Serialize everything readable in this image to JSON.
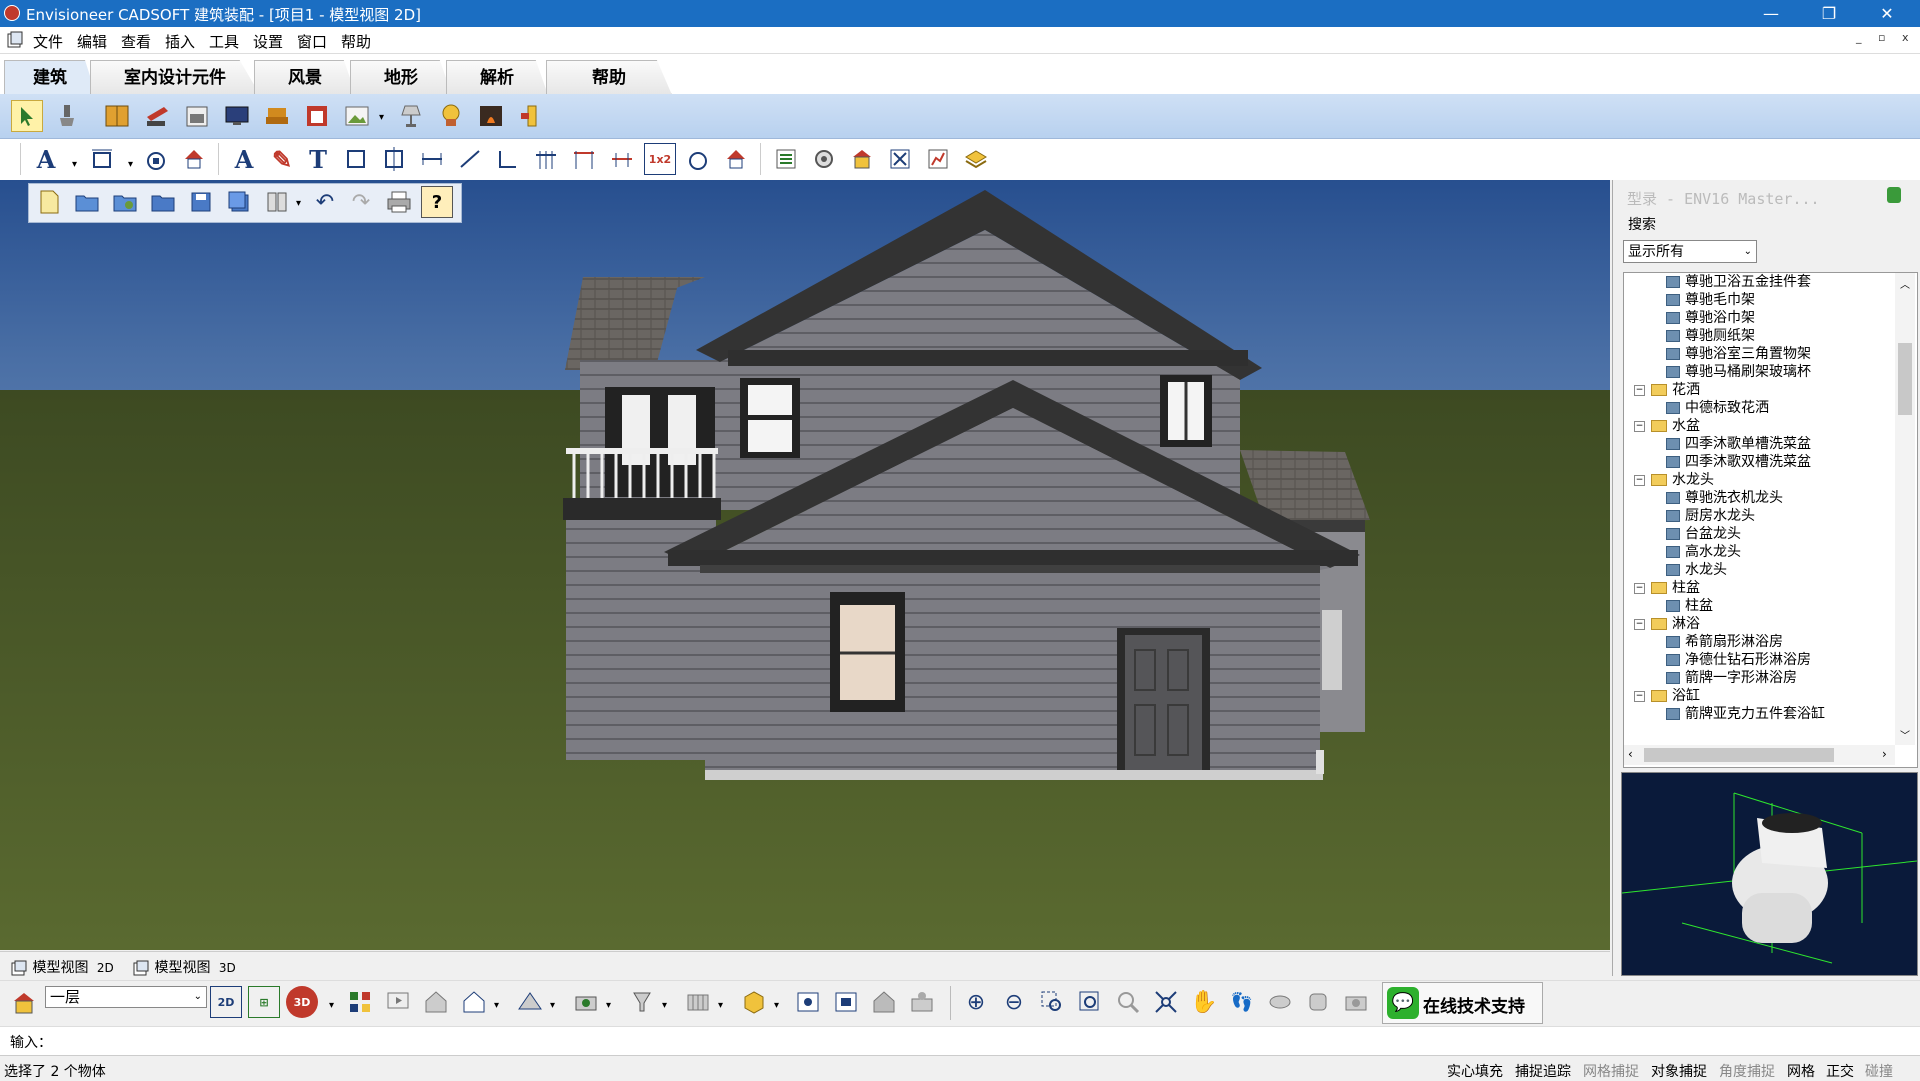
{
  "window": {
    "title": "Envisioneer CADSOFT 建筑装配 - [项目1 - 模型视图 2D]",
    "minimize": "—",
    "restore": "❐",
    "close": "✕"
  },
  "menu": [
    "文件",
    "编辑",
    "查看",
    "插入",
    "工具",
    "设置",
    "窗口",
    "帮助"
  ],
  "mdi": {
    "minimize": "_",
    "restore": "▫",
    "close": "x"
  },
  "tabs": [
    "建筑",
    "室内设计元件",
    "风景",
    "地形",
    "解析",
    "帮助"
  ],
  "ribbon2_text": {
    "a1": "A",
    "a2": "A",
    "t1": "T",
    "ratio": "1x2"
  },
  "panel": {
    "title": "型录 - ENV16 Master...",
    "search_label": "搜索",
    "filter_value": "显示所有",
    "tree": [
      {
        "label": "尊驰卫浴五金挂件套",
        "type": "item"
      },
      {
        "label": "尊驰毛巾架",
        "type": "item"
      },
      {
        "label": "尊驰浴巾架",
        "type": "item"
      },
      {
        "label": "尊驰厕纸架",
        "type": "item"
      },
      {
        "label": "尊驰浴室三角置物架",
        "type": "item"
      },
      {
        "label": "尊驰马桶刷架玻璃杯",
        "type": "item"
      },
      {
        "label": "花洒",
        "type": "folder"
      },
      {
        "label": "中德标致花洒",
        "type": "item"
      },
      {
        "label": "水盆",
        "type": "folder"
      },
      {
        "label": "四季沐歌单槽洗菜盆",
        "type": "item"
      },
      {
        "label": "四季沐歌双槽洗菜盆",
        "type": "item"
      },
      {
        "label": "水龙头",
        "type": "folder"
      },
      {
        "label": "尊驰洗衣机龙头",
        "type": "item"
      },
      {
        "label": "厨房水龙头",
        "type": "item"
      },
      {
        "label": "台盆龙头",
        "type": "item"
      },
      {
        "label": "高水龙头",
        "type": "item"
      },
      {
        "label": "水龙头",
        "type": "item"
      },
      {
        "label": "柱盆",
        "type": "folder"
      },
      {
        "label": "柱盆",
        "type": "item"
      },
      {
        "label": "淋浴",
        "type": "folder"
      },
      {
        "label": "希箭扇形淋浴房",
        "type": "item"
      },
      {
        "label": "净德仕钻石形淋浴房",
        "type": "item"
      },
      {
        "label": "箭牌一字形淋浴房",
        "type": "item"
      },
      {
        "label": "浴缸",
        "type": "folder"
      },
      {
        "label": "箭牌亚克力五件套浴缸",
        "type": "item"
      }
    ]
  },
  "view_tabs": [
    {
      "label": "模型视图",
      "suffix": "2D"
    },
    {
      "label": "模型视图",
      "suffix": "3D"
    }
  ],
  "bottom": {
    "floor": "一层",
    "d2": "2D",
    "d3": "3D",
    "support": "在线技术支持"
  },
  "cmd": {
    "label": "输入："
  },
  "status": {
    "left": "选择了 2 个物体",
    "toggles": [
      {
        "label": "实心填充",
        "active": true
      },
      {
        "label": "捕捉追踪",
        "active": true
      },
      {
        "label": "网格捕捉",
        "active": false
      },
      {
        "label": "对象捕捉",
        "active": true
      },
      {
        "label": "角度捕捉",
        "active": false
      },
      {
        "label": "网格",
        "active": true
      },
      {
        "label": "正交",
        "active": true
      },
      {
        "label": "碰撞",
        "active": false
      }
    ]
  },
  "colors": {
    "titlebar": "#1b6ec2",
    "ribbon": "#c4d9f2",
    "sky": "#3d5f93",
    "grass": "#4b5a2c",
    "siding": "#7a7a80"
  }
}
